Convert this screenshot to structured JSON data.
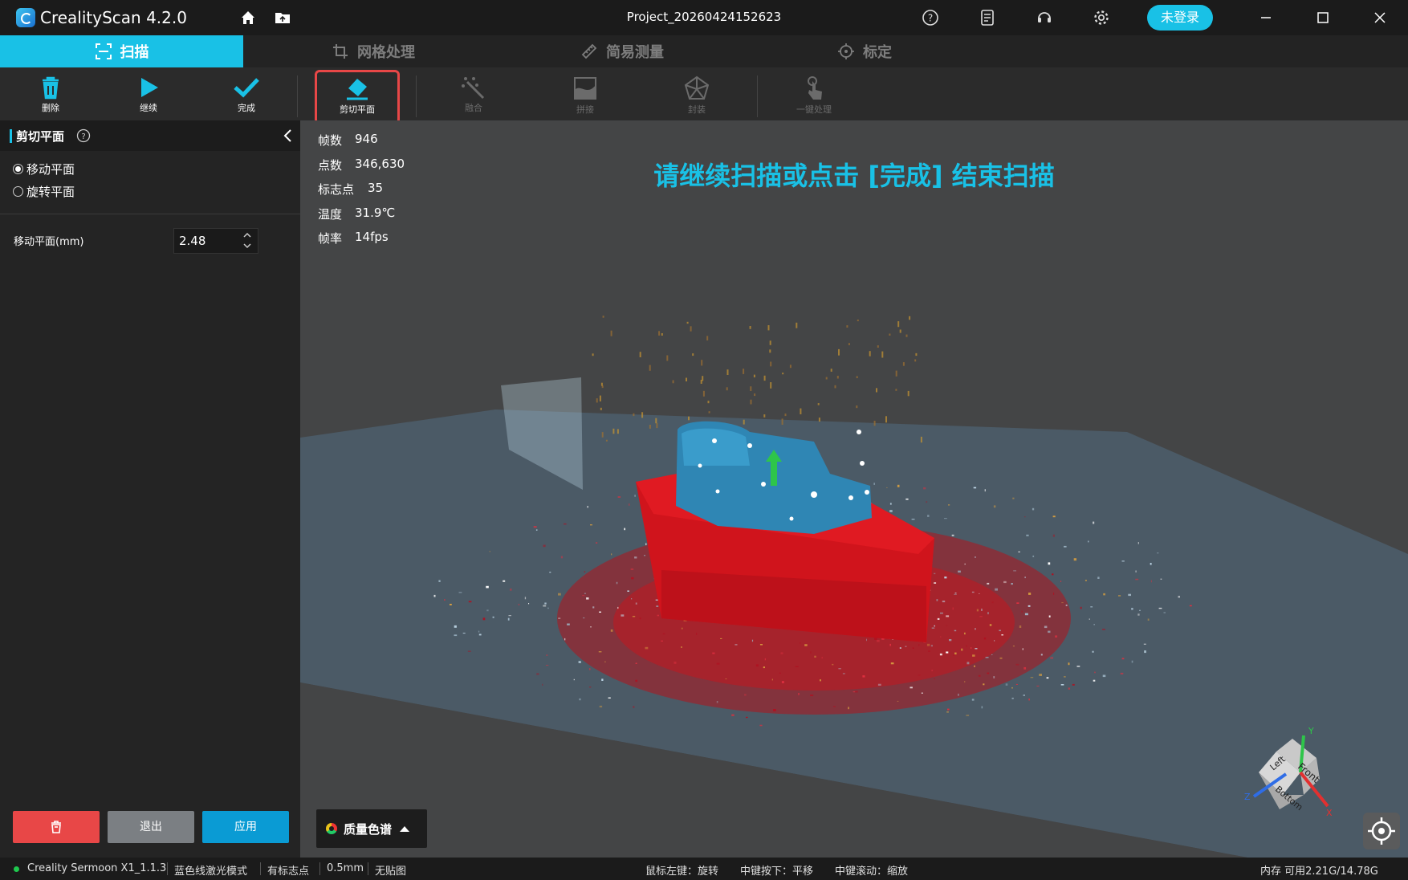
{
  "titlebar": {
    "app_name": "CrealityScan 4.2.0",
    "project_name": "Project_20260424152623",
    "login_label": "未登录",
    "icons": [
      "home-icon",
      "folder-icon",
      "help-icon",
      "notes-icon",
      "support-icon",
      "gear-icon",
      "minimize-icon",
      "maximize-icon",
      "close-icon"
    ]
  },
  "mode_tabs": [
    {
      "label": "扫描",
      "icon": "scan-icon",
      "active": true
    },
    {
      "label": "网格处理",
      "icon": "crop-icon",
      "active": false
    },
    {
      "label": "简易测量",
      "icon": "ruler-icon",
      "active": false
    },
    {
      "label": "标定",
      "icon": "target-icon",
      "active": false
    }
  ],
  "toolbar": {
    "delete_label": "删除",
    "continue_label": "继续",
    "finish_label": "完成",
    "cut_plane_label": "剪切平面",
    "fuse_label": "融合",
    "stitch_label": "拼接",
    "encapsulate_label": "封装",
    "oneclick_label": "一键处理"
  },
  "panel": {
    "title": "剪切平面",
    "radio_move": "移动平面",
    "radio_rotate": "旋转平面",
    "selected_mode": "移动平面",
    "move_label": "移动平面(mm)",
    "move_value": "2.48",
    "exit_label": "退出",
    "apply_label": "应用"
  },
  "stats": {
    "frames_label": "帧数",
    "frames_value": "946",
    "points_label": "点数",
    "points_value": "346,630",
    "markers_label": "标志点",
    "markers_value": "35",
    "temp_label": "温度",
    "temp_value": "31.9℃",
    "fps_label": "帧率",
    "fps_value": "14fps"
  },
  "banner": "请继续扫描或点击 [完成] 结束扫描",
  "quality_label": "质量色谱",
  "view_cube": {
    "top": "Left",
    "right": "Front",
    "bottom": "Bottom",
    "axis_y": "Y",
    "axis_x": "X",
    "axis_z": "Z"
  },
  "statusbar": {
    "device": "Creality Sermoon X1_1.1.3",
    "mode": "蓝色线激光模式",
    "markers": "有标志点",
    "resolution": "0.5mm",
    "texture": "无贴图",
    "hint_rotate": "鼠标左键：旋转",
    "hint_pan": "中键按下：平移",
    "hint_zoom": "中键滚动：缩放",
    "memory": "内存 可用2.21G/14.78G"
  },
  "colors": {
    "accent": "#19c1e6",
    "danger": "#e84747",
    "scan_red": "#d8141e",
    "model_blue": "#2f8ab6"
  }
}
